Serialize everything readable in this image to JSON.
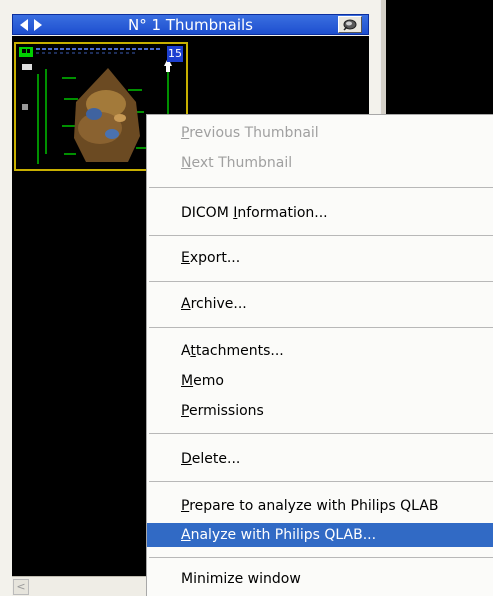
{
  "header": {
    "title": "N° 1 Thumbnails"
  },
  "thumbnail": {
    "number": "15"
  },
  "menu": {
    "items": [
      {
        "pre": "",
        "key": "P",
        "post": "revious Thumbnail",
        "state": "disabled"
      },
      {
        "pre": "",
        "key": "N",
        "post": "ext Thumbnail",
        "state": "disabled"
      },
      {
        "pre": "DICOM ",
        "key": "I",
        "post": "nformation...",
        "state": "normal"
      },
      {
        "pre": "",
        "key": "E",
        "post": "xport...",
        "state": "normal"
      },
      {
        "pre": "",
        "key": "A",
        "post": "rchive...",
        "state": "normal"
      },
      {
        "pre": "A",
        "key": "t",
        "post": "tachments...",
        "state": "normal"
      },
      {
        "pre": "",
        "key": "M",
        "post": "emo",
        "state": "normal"
      },
      {
        "pre": "",
        "key": "P",
        "post": "ermissions",
        "state": "normal"
      },
      {
        "pre": "",
        "key": "D",
        "post": "elete...",
        "state": "normal"
      },
      {
        "pre": "",
        "key": "P",
        "post": "repare to analyze with Philips QLAB",
        "state": "normal"
      },
      {
        "pre": "",
        "key": "A",
        "post": "nalyze with Philips QLAB...",
        "state": "selected"
      },
      {
        "pre": "Minimize window",
        "key": "",
        "post": "",
        "state": "normal"
      }
    ]
  },
  "colors": {
    "selection": "#316ac5",
    "titlebar": "#1e4fcf",
    "thumb_border": "#c8b000"
  }
}
